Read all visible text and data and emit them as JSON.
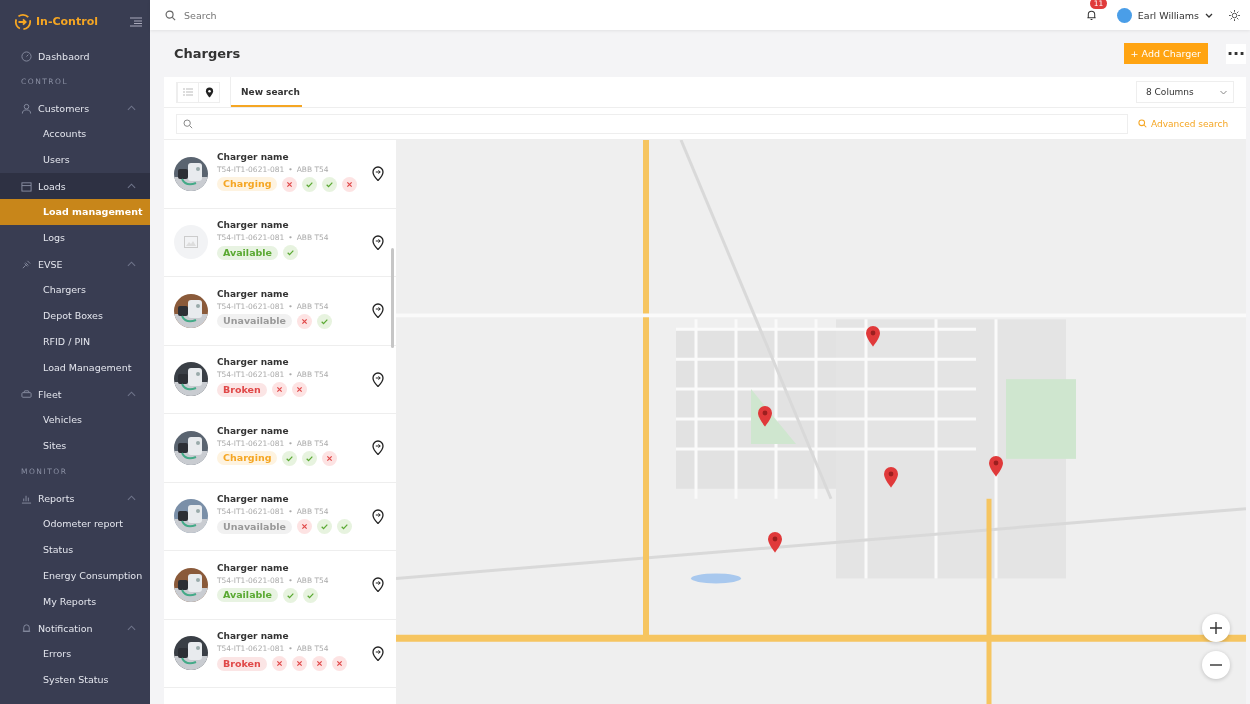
{
  "brand": {
    "name": "In-Control"
  },
  "sidebar": {
    "items": [
      {
        "kind": "link",
        "label": "Dashbaord",
        "selected": false
      },
      {
        "kind": "section",
        "label": "CONTROL"
      },
      {
        "kind": "group",
        "label": "Customers",
        "expanded": true,
        "selected": false,
        "children": [
          {
            "label": "Accounts",
            "selected": false
          },
          {
            "label": "Users",
            "selected": false
          }
        ]
      },
      {
        "kind": "group",
        "label": "Loads",
        "expanded": true,
        "selected": true,
        "children": [
          {
            "label": "Load management",
            "selected": true
          },
          {
            "label": "Logs",
            "selected": false
          }
        ]
      },
      {
        "kind": "group",
        "label": "EVSE",
        "expanded": true,
        "selected": false,
        "children": [
          {
            "label": "Chargers",
            "selected": false
          },
          {
            "label": "Depot Boxes",
            "selected": false
          },
          {
            "label": "RFID / PIN",
            "selected": false
          },
          {
            "label": "Load Management",
            "selected": false
          }
        ]
      },
      {
        "kind": "group",
        "label": "Fleet",
        "expanded": true,
        "selected": false,
        "children": [
          {
            "label": "Vehicles",
            "selected": false
          },
          {
            "label": "Sites",
            "selected": false
          }
        ]
      },
      {
        "kind": "section",
        "label": "MONITOR"
      },
      {
        "kind": "group",
        "label": "Reports",
        "expanded": true,
        "selected": false,
        "children": [
          {
            "label": "Odometer report",
            "selected": false
          },
          {
            "label": "Status",
            "selected": false
          },
          {
            "label": "Energy Consumption",
            "selected": false
          },
          {
            "label": "My Reports",
            "selected": false
          }
        ]
      },
      {
        "kind": "group",
        "label": "Notification",
        "expanded": true,
        "selected": false,
        "children": [
          {
            "label": "Errors",
            "selected": false
          },
          {
            "label": "Systen Status",
            "selected": false
          }
        ]
      }
    ]
  },
  "topbar": {
    "search": {
      "placeholder": "Search"
    },
    "notifications": "11",
    "user": "Earl Williams"
  },
  "page": {
    "title": "Chargers",
    "add_button": "+ Add Charger",
    "more_button": "···"
  },
  "toolbar": {
    "views": [
      {
        "kind": "list",
        "selected": false
      },
      {
        "kind": "map",
        "selected": true
      }
    ],
    "tabs": [
      {
        "label": "New search",
        "selected": true
      }
    ],
    "columns": "8 Columns",
    "advanced_search": "Advanced search"
  },
  "rows": [
    {
      "name": "Charger name",
      "serial": "T54-IT1-0621-081",
      "separator": "•",
      "model": "ABB T54",
      "status": {
        "label": "Charging",
        "color": "#f5a623"
      },
      "has_photo": true,
      "checks": [
        false,
        true,
        true,
        false
      ]
    },
    {
      "name": "Charger name",
      "serial": "T54-IT1-0621-081",
      "separator": "•",
      "model": "ABB T54",
      "status": {
        "label": "Available",
        "color": "#5aa932"
      },
      "has_photo": false,
      "checks": [
        true
      ]
    },
    {
      "name": "Charger name",
      "serial": "T54-IT1-0621-081",
      "separator": "•",
      "model": "ABB T54",
      "status": {
        "label": "Unavailable",
        "color": "#999999"
      },
      "has_photo": true,
      "checks": [
        false,
        true
      ]
    },
    {
      "name": "Charger name",
      "serial": "T54-IT1-0621-081",
      "separator": "•",
      "model": "ABB T54",
      "status": {
        "label": "Broken",
        "color": "#e04848"
      },
      "has_photo": true,
      "checks": [
        false,
        false
      ]
    },
    {
      "name": "Charger name",
      "serial": "T54-IT1-0621-081",
      "separator": "•",
      "model": "ABB T54",
      "status": {
        "label": "Charging",
        "color": "#f5a623"
      },
      "has_photo": true,
      "checks": [
        true,
        true,
        false
      ]
    },
    {
      "name": "Charger name",
      "serial": "T54-IT1-0621-081",
      "separator": "•",
      "model": "ABB T54",
      "status": {
        "label": "Unavailable",
        "color": "#999999"
      },
      "has_photo": true,
      "checks": [
        false,
        true,
        true
      ]
    },
    {
      "name": "Charger name",
      "serial": "T54-IT1-0621-081",
      "separator": "•",
      "model": "ABB T54",
      "status": {
        "label": "Available",
        "color": "#5aa932"
      },
      "has_photo": true,
      "checks": [
        true,
        true
      ]
    },
    {
      "name": "Charger name",
      "serial": "T54-IT1-0621-081",
      "separator": "•",
      "model": "ABB T54",
      "status": {
        "label": "Broken",
        "color": "#e04848"
      },
      "has_photo": true,
      "checks": [
        false,
        false,
        false,
        false
      ]
    }
  ]
}
